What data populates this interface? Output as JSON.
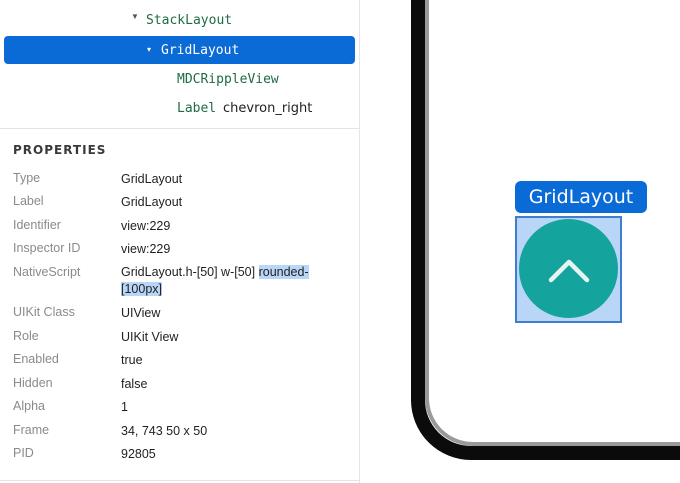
{
  "tree": {
    "stack_layout": "StackLayout",
    "grid_layout": "GridLayout",
    "ripple_view": "MDCRippleView",
    "label_node": "Label",
    "label_text": "chevron_right"
  },
  "properties": {
    "title": "PROPERTIES",
    "rows": [
      {
        "key": "Type",
        "value": "GridLayout"
      },
      {
        "key": "Label",
        "value": "GridLayout"
      },
      {
        "key": "Identifier",
        "value": "view:229"
      },
      {
        "key": "Inspector ID",
        "value": "view:229"
      },
      {
        "key": "NativeScript",
        "value_plain": "GridLayout.h-[50] w-[50] ",
        "value_hl1": "rounded-",
        "value_hl2": "[100px]"
      },
      {
        "key": "UIKit Class",
        "value": "UIView"
      },
      {
        "key": "Role",
        "value": "UIKit View"
      },
      {
        "key": "Enabled",
        "value": "true"
      },
      {
        "key": "Hidden",
        "value": "false"
      },
      {
        "key": "Alpha",
        "value": "1"
      },
      {
        "key": "Frame",
        "value": "34, 743 50 x 50"
      },
      {
        "key": "PID",
        "value": "92805"
      }
    ]
  },
  "preview": {
    "selection_tag": "GridLayout",
    "fab_icon": "chevron-up-icon"
  },
  "colors": {
    "selection": "#0a6ad6",
    "highlight": "#b9d5f7",
    "fab": "#15a39d",
    "tree_text": "#1f6b44"
  }
}
